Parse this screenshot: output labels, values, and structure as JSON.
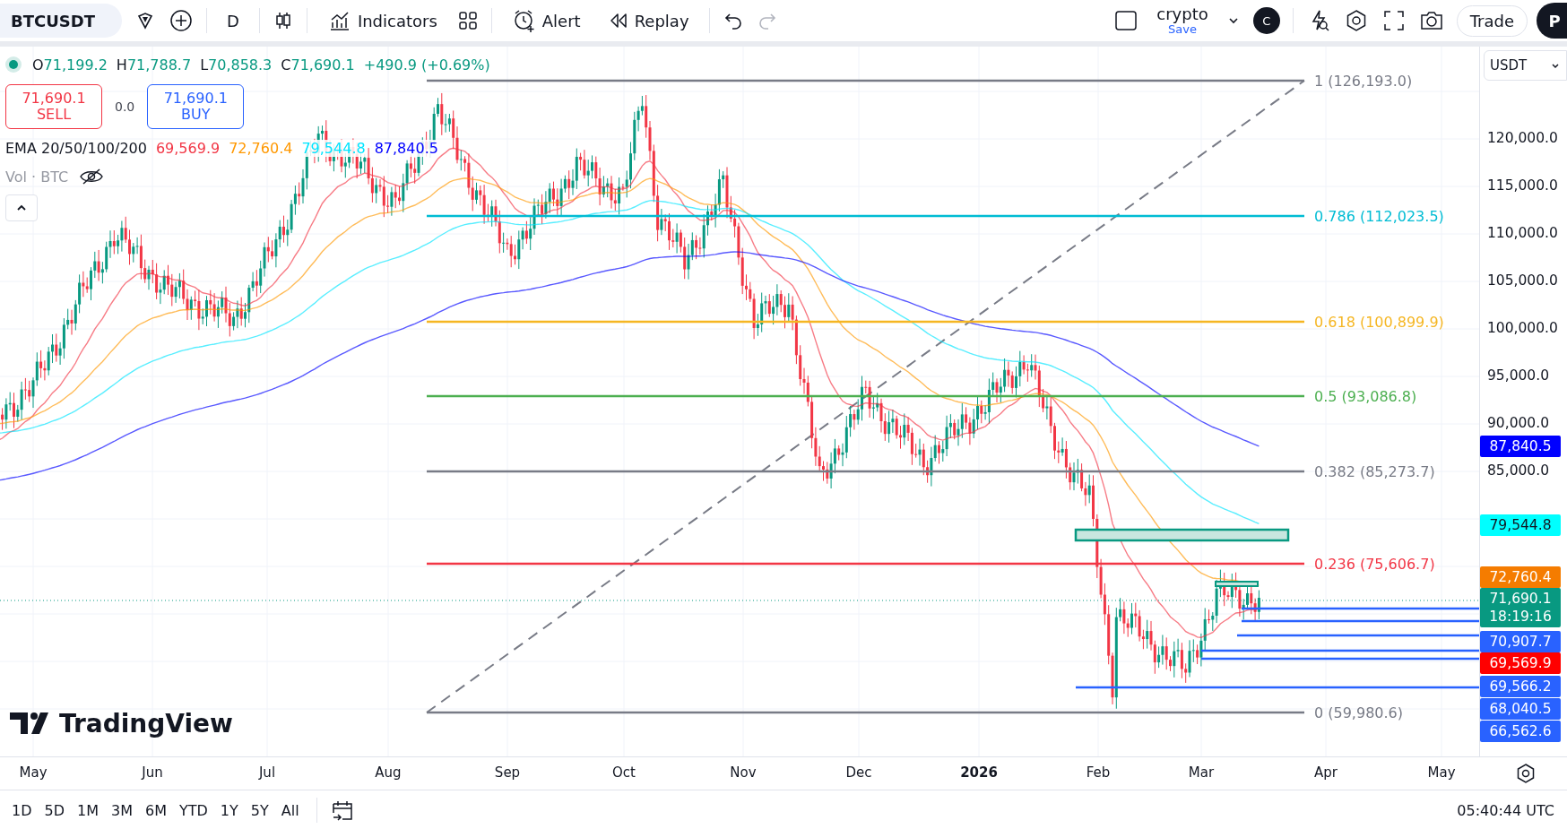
{
  "toolbar": {
    "symbol": "BTCUSDT",
    "interval": "D",
    "indicators_label": "Indicators",
    "alert_label": "Alert",
    "replay_label": "Replay",
    "history": [
      {
        "kind": "undo",
        "disabled": false
      },
      {
        "kind": "redo",
        "disabled": true
      }
    ],
    "layout": {
      "name": "crypto",
      "status": "Save"
    },
    "avatar_letter": "C",
    "trade_label": "Trade",
    "profile_letter": "P"
  },
  "legend": {
    "ohlc": [
      {
        "key": "O",
        "value": "71,199.2"
      },
      {
        "key": "H",
        "value": "71,788.7"
      },
      {
        "key": "L",
        "value": "70,858.3"
      },
      {
        "key": "C",
        "value": "71,690.1"
      }
    ],
    "change": "+490.9 (+0.69%)",
    "sell": {
      "price": "71,690.1",
      "label": "SELL"
    },
    "spread": "0.0",
    "buy": {
      "price": "71,690.1",
      "label": "BUY"
    },
    "indicator": {
      "name": "EMA 20/50/100/200",
      "values": [
        {
          "value": "69,569.9",
          "color": "#f23645"
        },
        {
          "value": "72,760.4",
          "color": "#ff9800"
        },
        {
          "value": "79,544.8",
          "color": "#00e5ff"
        },
        {
          "value": "87,840.5",
          "color": "#0000ff"
        }
      ]
    },
    "volume": {
      "label": "Vol · BTC",
      "hidden": true
    }
  },
  "chart": {
    "logo_text": "TradingView",
    "fib_levels": [
      {
        "label": "1 (126,193.0)",
        "color": "#787b86"
      },
      {
        "label": "0.786 (112,023.5)",
        "color": "#00bcd4"
      },
      {
        "label": "0.618 (100,899.9)",
        "color": "#f5b623"
      },
      {
        "label": "0.5 (93,086.8)",
        "color": "#4caf50"
      },
      {
        "label": "0.382 (85,273.7)",
        "color": "#787b86"
      },
      {
        "label": "0.236 (75,606.7)",
        "color": "#f23645"
      },
      {
        "label": "0 (59,980.6)",
        "color": "#787b86"
      }
    ],
    "time_labels": [
      {
        "text": "May",
        "kind": "month"
      },
      {
        "text": "Jun",
        "kind": "month"
      },
      {
        "text": "Jul",
        "kind": "month"
      },
      {
        "text": "Aug",
        "kind": "month"
      },
      {
        "text": "Sep",
        "kind": "month"
      },
      {
        "text": "Oct",
        "kind": "month"
      },
      {
        "text": "Nov",
        "kind": "month"
      },
      {
        "text": "Dec",
        "kind": "month"
      },
      {
        "text": "2026",
        "kind": "year"
      },
      {
        "text": "Feb",
        "kind": "month"
      },
      {
        "text": "Mar",
        "kind": "month"
      },
      {
        "text": "Apr",
        "kind": "month"
      },
      {
        "text": "May",
        "kind": "month"
      }
    ]
  },
  "price_axis": {
    "currency": "USDT",
    "ticks": [
      "120,000.0",
      "115,000.0",
      "110,000.0",
      "105,000.0",
      "100,000.0",
      "95,000.0",
      "90,000.0",
      "85,000.0"
    ],
    "tags": [
      {
        "text": "87,840.5",
        "color": "#0000ff"
      },
      {
        "text": "79,544.8",
        "color": "#00ffff"
      },
      {
        "text": "72,760.4",
        "color": "#f57c00"
      },
      {
        "text": "71,690.1",
        "countdown": "18:19:16",
        "color": "#089981"
      },
      {
        "text": "70,907.7",
        "color": "#2962ff"
      },
      {
        "text": "69,569.9",
        "color": "#ff0000"
      },
      {
        "text": "69,566.2",
        "color": "#2962ff"
      },
      {
        "text": "68,040.5",
        "color": "#2962ff"
      },
      {
        "text": "66,562.6",
        "color": "#2962ff"
      }
    ]
  },
  "range_buttons": [
    "1D",
    "5D",
    "1M",
    "3M",
    "6M",
    "YTD",
    "1Y",
    "5Y",
    "All"
  ],
  "clock": "05:40:44 UTC"
}
